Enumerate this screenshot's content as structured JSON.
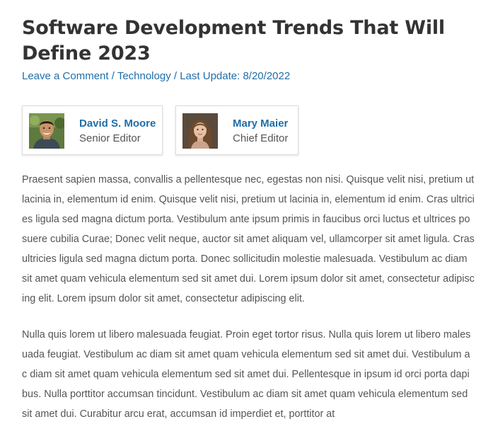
{
  "article": {
    "title": "Software Development Trends That Will Define 2023",
    "meta": {
      "comment_link": "Leave a Comment",
      "separator": " / ",
      "category": "Technology",
      "last_update": "Last Update: 8/20/2022"
    },
    "authors": [
      {
        "name": "David S. Moore",
        "role": "Senior Editor",
        "avatar_icon": "male-portrait"
      },
      {
        "name": "Mary Maier",
        "role": "Chief Editor",
        "avatar_icon": "female-portrait"
      }
    ],
    "paragraphs": [
      "Praesent sapien massa, convallis a pellentesque nec, egestas non nisi. Quisque velit nisi, pretium ut lacinia in, elementum id enim. Quisque velit nisi, pretium ut lacinia in, elementum id enim. Cras ultricies ligula sed magna dictum porta. Vestibulum ante ipsum primis in faucibus orci luctus et ultrices posuere cubilia Curae; Donec velit neque, auctor sit amet aliquam vel, ullamcorper sit amet ligula. Cras ultricies ligula sed magna dictum porta. Donec sollicitudin molestie malesuada. Vestibulum ac diam sit amet quam vehicula elementum sed sit amet dui. Lorem ipsum dolor sit amet, consectetur adipiscing elit. Lorem ipsum dolor sit amet, consectetur adipiscing elit.",
      "Nulla quis lorem ut libero malesuada feugiat. Proin eget tortor risus. Nulla quis lorem ut libero malesuada feugiat. Vestibulum ac diam sit amet quam vehicula elementum sed sit amet dui. Vestibulum ac diam sit amet quam vehicula elementum sed sit amet dui. Pellentesque in ipsum id orci porta dapibus. Nulla porttitor accumsan tincidunt. Vestibulum ac diam sit amet quam vehicula elementum sed sit amet dui. Curabitur arcu erat, accumsan id imperdiet et, porttitor at"
    ]
  },
  "colors": {
    "link": "#1f6ea8",
    "title": "#333333",
    "body_text": "#555555",
    "card_border": "#dcdcdc"
  }
}
